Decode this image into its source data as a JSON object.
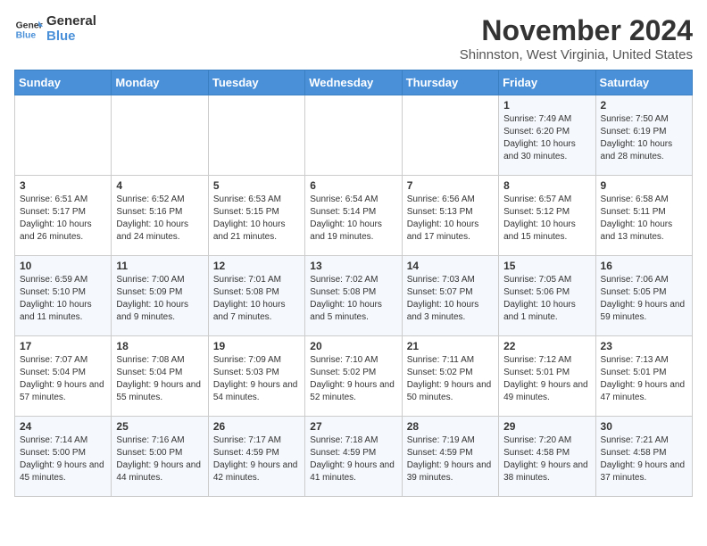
{
  "header": {
    "logo_line1": "General",
    "logo_line2": "Blue",
    "month": "November 2024",
    "location": "Shinnston, West Virginia, United States"
  },
  "weekdays": [
    "Sunday",
    "Monday",
    "Tuesday",
    "Wednesday",
    "Thursday",
    "Friday",
    "Saturday"
  ],
  "weeks": [
    [
      {
        "day": "",
        "info": ""
      },
      {
        "day": "",
        "info": ""
      },
      {
        "day": "",
        "info": ""
      },
      {
        "day": "",
        "info": ""
      },
      {
        "day": "",
        "info": ""
      },
      {
        "day": "1",
        "info": "Sunrise: 7:49 AM\nSunset: 6:20 PM\nDaylight: 10 hours and 30 minutes."
      },
      {
        "day": "2",
        "info": "Sunrise: 7:50 AM\nSunset: 6:19 PM\nDaylight: 10 hours and 28 minutes."
      }
    ],
    [
      {
        "day": "3",
        "info": "Sunrise: 6:51 AM\nSunset: 5:17 PM\nDaylight: 10 hours and 26 minutes."
      },
      {
        "day": "4",
        "info": "Sunrise: 6:52 AM\nSunset: 5:16 PM\nDaylight: 10 hours and 24 minutes."
      },
      {
        "day": "5",
        "info": "Sunrise: 6:53 AM\nSunset: 5:15 PM\nDaylight: 10 hours and 21 minutes."
      },
      {
        "day": "6",
        "info": "Sunrise: 6:54 AM\nSunset: 5:14 PM\nDaylight: 10 hours and 19 minutes."
      },
      {
        "day": "7",
        "info": "Sunrise: 6:56 AM\nSunset: 5:13 PM\nDaylight: 10 hours and 17 minutes."
      },
      {
        "day": "8",
        "info": "Sunrise: 6:57 AM\nSunset: 5:12 PM\nDaylight: 10 hours and 15 minutes."
      },
      {
        "day": "9",
        "info": "Sunrise: 6:58 AM\nSunset: 5:11 PM\nDaylight: 10 hours and 13 minutes."
      }
    ],
    [
      {
        "day": "10",
        "info": "Sunrise: 6:59 AM\nSunset: 5:10 PM\nDaylight: 10 hours and 11 minutes."
      },
      {
        "day": "11",
        "info": "Sunrise: 7:00 AM\nSunset: 5:09 PM\nDaylight: 10 hours and 9 minutes."
      },
      {
        "day": "12",
        "info": "Sunrise: 7:01 AM\nSunset: 5:08 PM\nDaylight: 10 hours and 7 minutes."
      },
      {
        "day": "13",
        "info": "Sunrise: 7:02 AM\nSunset: 5:08 PM\nDaylight: 10 hours and 5 minutes."
      },
      {
        "day": "14",
        "info": "Sunrise: 7:03 AM\nSunset: 5:07 PM\nDaylight: 10 hours and 3 minutes."
      },
      {
        "day": "15",
        "info": "Sunrise: 7:05 AM\nSunset: 5:06 PM\nDaylight: 10 hours and 1 minute."
      },
      {
        "day": "16",
        "info": "Sunrise: 7:06 AM\nSunset: 5:05 PM\nDaylight: 9 hours and 59 minutes."
      }
    ],
    [
      {
        "day": "17",
        "info": "Sunrise: 7:07 AM\nSunset: 5:04 PM\nDaylight: 9 hours and 57 minutes."
      },
      {
        "day": "18",
        "info": "Sunrise: 7:08 AM\nSunset: 5:04 PM\nDaylight: 9 hours and 55 minutes."
      },
      {
        "day": "19",
        "info": "Sunrise: 7:09 AM\nSunset: 5:03 PM\nDaylight: 9 hours and 54 minutes."
      },
      {
        "day": "20",
        "info": "Sunrise: 7:10 AM\nSunset: 5:02 PM\nDaylight: 9 hours and 52 minutes."
      },
      {
        "day": "21",
        "info": "Sunrise: 7:11 AM\nSunset: 5:02 PM\nDaylight: 9 hours and 50 minutes."
      },
      {
        "day": "22",
        "info": "Sunrise: 7:12 AM\nSunset: 5:01 PM\nDaylight: 9 hours and 49 minutes."
      },
      {
        "day": "23",
        "info": "Sunrise: 7:13 AM\nSunset: 5:01 PM\nDaylight: 9 hours and 47 minutes."
      }
    ],
    [
      {
        "day": "24",
        "info": "Sunrise: 7:14 AM\nSunset: 5:00 PM\nDaylight: 9 hours and 45 minutes."
      },
      {
        "day": "25",
        "info": "Sunrise: 7:16 AM\nSunset: 5:00 PM\nDaylight: 9 hours and 44 minutes."
      },
      {
        "day": "26",
        "info": "Sunrise: 7:17 AM\nSunset: 4:59 PM\nDaylight: 9 hours and 42 minutes."
      },
      {
        "day": "27",
        "info": "Sunrise: 7:18 AM\nSunset: 4:59 PM\nDaylight: 9 hours and 41 minutes."
      },
      {
        "day": "28",
        "info": "Sunrise: 7:19 AM\nSunset: 4:59 PM\nDaylight: 9 hours and 39 minutes."
      },
      {
        "day": "29",
        "info": "Sunrise: 7:20 AM\nSunset: 4:58 PM\nDaylight: 9 hours and 38 minutes."
      },
      {
        "day": "30",
        "info": "Sunrise: 7:21 AM\nSunset: 4:58 PM\nDaylight: 9 hours and 37 minutes."
      }
    ]
  ]
}
